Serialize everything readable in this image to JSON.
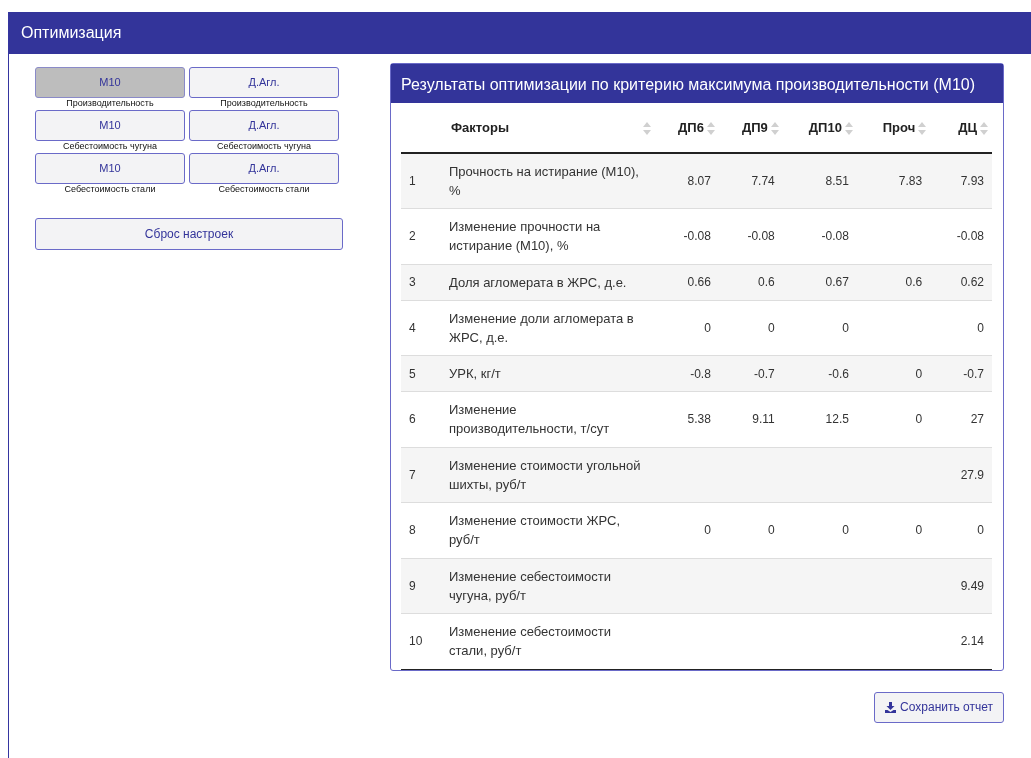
{
  "panel": {
    "title": "Оптимизация"
  },
  "criteria": [
    {
      "label": "М10",
      "caption": "Производительность",
      "selected": true
    },
    {
      "label": "Д.Агл.",
      "caption": "Производительность",
      "selected": false
    },
    {
      "label": "М10",
      "caption": "Себестоимость чугуна",
      "selected": false
    },
    {
      "label": "Д.Агл.",
      "caption": "Себестоимость чугуна",
      "selected": false
    },
    {
      "label": "М10",
      "caption": "Себестоимость стали",
      "selected": false
    },
    {
      "label": "Д.Агл.",
      "caption": "Себестоимость стали",
      "selected": false
    }
  ],
  "reset_button": "Сброс настроек",
  "results": {
    "title": "Результаты оптимизации по критерию максимума производительности (М10)",
    "table": {
      "columns": [
        "Факторы",
        "ДП6",
        "ДП9",
        "ДП10",
        "Проч",
        "ДЦ"
      ],
      "rows": [
        {
          "number": "1",
          "cells": [
            "Прочность на истирание (М10), %",
            "8.07",
            "7.74",
            "8.51",
            "7.83",
            "7.93"
          ]
        },
        {
          "number": "2",
          "cells": [
            "Изменение прочности на истирание (М10), %",
            "-0.08",
            "-0.08",
            "-0.08",
            null,
            "-0.08"
          ]
        },
        {
          "number": "3",
          "cells": [
            "Доля агломерата в ЖРС, д.е.",
            "0.66",
            "0.6",
            "0.67",
            "0.6",
            "0.62"
          ]
        },
        {
          "number": "4",
          "cells": [
            "Изменение доли агломерата в ЖРС, д.е.",
            "0",
            "0",
            "0",
            null,
            "0"
          ]
        },
        {
          "number": "5",
          "cells": [
            "УРК, кг/т",
            "-0.8",
            "-0.7",
            "-0.6",
            "0",
            "-0.7"
          ]
        },
        {
          "number": "6",
          "cells": [
            "Изменение производительности, т/сут",
            "5.38",
            "9.11",
            "12.5",
            "0",
            "27"
          ]
        },
        {
          "number": "7",
          "cells": [
            "Изменение стоимости угольной шихты, руб/т",
            null,
            null,
            null,
            null,
            "27.9"
          ]
        },
        {
          "number": "8",
          "cells": [
            "Изменение стоимости ЖРС, руб/т",
            "0",
            "0",
            "0",
            "0",
            "0"
          ]
        },
        {
          "number": "9",
          "cells": [
            "Изменение себестоимости чугуна, руб/т",
            null,
            null,
            null,
            null,
            "9.49"
          ]
        },
        {
          "number": "10",
          "cells": [
            "Изменение себестоимости стали, руб/т",
            null,
            null,
            null,
            null,
            "2.14"
          ]
        }
      ]
    }
  },
  "save_button": "Сохранить отчет"
}
